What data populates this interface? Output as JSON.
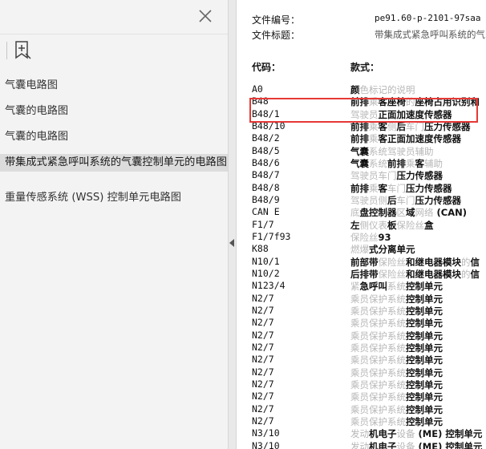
{
  "sidebar": {
    "bookmarks": [
      {
        "label": "气囊电路图"
      },
      {
        "label": "气囊的电路图"
      },
      {
        "label": "气囊的电路图"
      },
      {
        "label": "带集成式紧急呼叫系统的气囊控制单元的电路图",
        "selected": true
      },
      {
        "label": "重量传感系统 (WSS) 控制单元电路图"
      }
    ]
  },
  "document": {
    "file_number_label": "文件编号：",
    "file_number_value": "pe91.60-p-2101-97saa",
    "file_title_label": "文件标题：",
    "file_title_value": "带集成式紧急呼叫系统的气",
    "col_code": "代码：",
    "col_style": "款式：",
    "rows": [
      {
        "code": "A0",
        "desc": "颜色标记的说明"
      },
      {
        "code": "B48",
        "desc": "前排乘客座椅的座椅占用识别和"
      },
      {
        "code": "B48/1",
        "desc": "驾驶员正面加速度传感器"
      },
      {
        "code": "B48/10",
        "desc": "前排乘客侧后车门压力传感器"
      },
      {
        "code": "B48/2",
        "desc": "前排乘客正面加速度传感器"
      },
      {
        "code": "B48/5",
        "desc": "气囊系统驾驶员辅助"
      },
      {
        "code": "B48/6",
        "desc": "气囊系统前排乘客辅助"
      },
      {
        "code": "B48/7",
        "desc": "驾驶员车门压力传感器"
      },
      {
        "code": "B48/8",
        "desc": "前排乘客车门压力传感器"
      },
      {
        "code": "B48/9",
        "desc": "驾驶员侧后车门压力传感器"
      },
      {
        "code": "CAN E",
        "desc": "底盘控制器区域网络 (CAN)"
      },
      {
        "code": "F1/7",
        "desc": "左侧仪表板保险丝盒"
      },
      {
        "code": "F1/7f93",
        "desc": "保险丝93"
      },
      {
        "code": "K88",
        "desc": "燃爆式分离单元"
      },
      {
        "code": "N10/1",
        "desc": "前部带保险丝和继电器模块的信"
      },
      {
        "code": "N10/2",
        "desc": "后排带保险丝和继电器模块的信"
      },
      {
        "code": "N123/4",
        "desc": "紧急呼叫系统控制单元"
      },
      {
        "code": "N2/7",
        "desc": "乘员保护系统控制单元"
      },
      {
        "code": "N2/7",
        "desc": "乘员保护系统控制单元"
      },
      {
        "code": "N2/7",
        "desc": "乘员保护系统控制单元"
      },
      {
        "code": "N2/7",
        "desc": "乘员保护系统控制单元"
      },
      {
        "code": "N2/7",
        "desc": "乘员保护系统控制单元"
      },
      {
        "code": "N2/7",
        "desc": "乘员保护系统控制单元"
      },
      {
        "code": "N2/7",
        "desc": "乘员保护系统控制单元"
      },
      {
        "code": "N2/7",
        "desc": "乘员保护系统控制单元"
      },
      {
        "code": "N2/7",
        "desc": "乘员保护系统控制单元"
      },
      {
        "code": "N2/7",
        "desc": "乘员保护系统控制单元"
      },
      {
        "code": "N2/7",
        "desc": "乘员保护系统控制单元"
      },
      {
        "code": "N3/10",
        "desc": "发动机电子设备 (ME) 控制单元"
      },
      {
        "code": "N3/10",
        "desc": "发动机电子设备 (ME) 控制单元"
      },
      {
        "code": "N3/10",
        "desc": "发动机电子设备 (ME) 控制单元"
      }
    ]
  },
  "colors": {
    "highlight_box": "#e53935",
    "light_text": "#b7b7b7"
  },
  "icons": [
    "close-icon",
    "bookmark-add-icon",
    "collapse-arrow-icon"
  ]
}
